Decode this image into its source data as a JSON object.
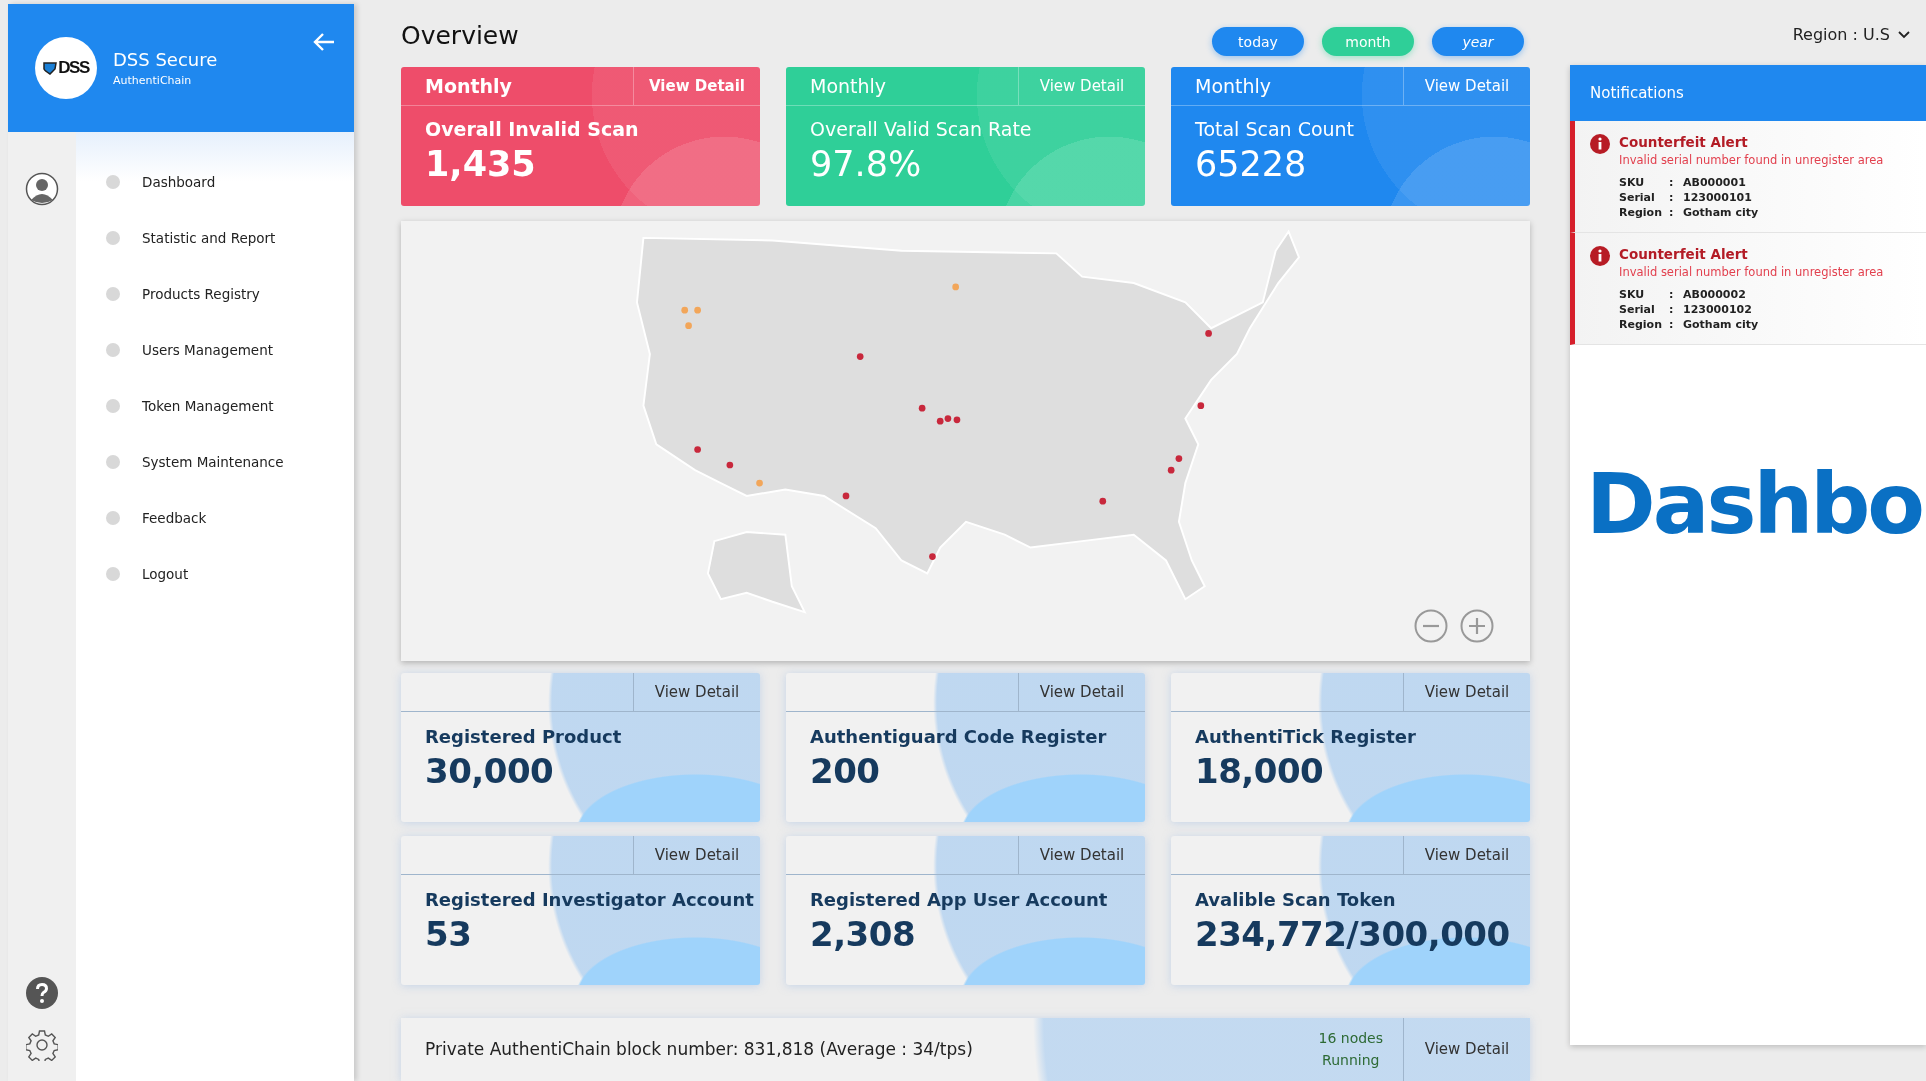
{
  "sidebar": {
    "brand": {
      "logo": "DSS",
      "title": "DSS Secure",
      "subtitle": "AuthentiChain"
    },
    "menu": [
      {
        "label": "Dashboard"
      },
      {
        "label": "Statistic and Report"
      },
      {
        "label": "Products Registry"
      },
      {
        "label": "Users Management"
      },
      {
        "label": "Token Management"
      },
      {
        "label": "System Maintenance"
      },
      {
        "label": "Feedback"
      },
      {
        "label": "Logout"
      }
    ]
  },
  "overview": {
    "title": "Overview",
    "filters": [
      {
        "label": "today",
        "selected": false,
        "italic": false
      },
      {
        "label": "month",
        "selected": true,
        "italic": false
      },
      {
        "label": "year",
        "selected": false,
        "italic": true
      }
    ],
    "stat_cards": [
      {
        "period": "Monthly",
        "action": "View Detail",
        "title": "Overall Invalid Scan",
        "value": "1,435",
        "color": "#ee4d6a",
        "bold": true
      },
      {
        "period": "Monthly",
        "action": "View Detail",
        "title": "Overall Valid Scan Rate",
        "value": "97.8%",
        "color": "#2fcf98",
        "bold": false
      },
      {
        "period": "Monthly",
        "action": "View Detail",
        "title": "Total Scan Count",
        "value": "65228",
        "color": "#1f88ef",
        "bold": false
      }
    ],
    "info_cards": [
      {
        "action": "View Detail",
        "title": "Registered Product",
        "value": "30,000"
      },
      {
        "action": "View Detail",
        "title": "Authentiguard Code Register",
        "value": "200"
      },
      {
        "action": "View Detail",
        "title": "AuthentiTick Register",
        "value": "18,000"
      },
      {
        "action": "View Detail",
        "title": "Registered Investigator Account",
        "value": "53"
      },
      {
        "action": "View Detail",
        "title": "Registered App User Account",
        "value": "2,308"
      },
      {
        "action": "View Detail",
        "title": "Avalible Scan Token",
        "value": "234,772/300,000"
      }
    ],
    "block_bar": {
      "text": "Private AuthentiChain block number: 831,818 (Average : 34/tps)",
      "nodes": "16 nodes",
      "status": "Running",
      "action": "View Detail"
    }
  },
  "region": {
    "label": "Region : U.S"
  },
  "notifications": {
    "title": "Notifications",
    "items": [
      {
        "title": "Counterfeit Alert",
        "message": "Invalid serial number found in unregister area",
        "fields": [
          {
            "label": "SKU",
            "sep": ":",
            "value": "AB000001"
          },
          {
            "label": "Serial",
            "sep": ":",
            "value": "123000101"
          },
          {
            "label": "Region",
            "sep": ":",
            "value": "Gotham city"
          }
        ]
      },
      {
        "title": "Counterfeit Alert",
        "message": "Invalid serial number found in unregister area",
        "fields": [
          {
            "label": "SKU",
            "sep": ":",
            "value": "AB000002"
          },
          {
            "label": "Serial",
            "sep": ":",
            "value": "123000102"
          },
          {
            "label": "Region",
            "sep": ":",
            "value": "Gotham city"
          }
        ]
      }
    ]
  },
  "overlay_title": "Dashbo"
}
